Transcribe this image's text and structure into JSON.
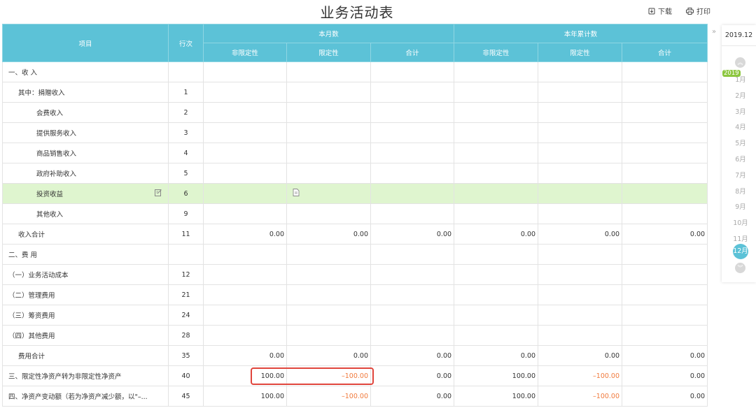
{
  "title": "业务活动表",
  "toolbar": {
    "download": "下载",
    "print": "打印"
  },
  "header": {
    "item": "项目",
    "line": "行次",
    "month_group": "本月数",
    "year_group": "本年累计数",
    "sub": [
      "非限定性",
      "限定性",
      "合计",
      "非限定性",
      "限定性",
      "合计"
    ]
  },
  "rows": [
    {
      "label": "一、收 入",
      "indent": 0,
      "line": "",
      "values": [
        "",
        "",
        "",
        "",
        "",
        ""
      ]
    },
    {
      "label": "其中：捐赠收入",
      "indent": 1,
      "line": "1",
      "values": [
        "",
        "",
        "",
        "",
        "",
        ""
      ]
    },
    {
      "label": "会费收入",
      "indent": 2,
      "line": "2",
      "values": [
        "",
        "",
        "",
        "",
        "",
        ""
      ]
    },
    {
      "label": "提供服务收入",
      "indent": 2,
      "line": "3",
      "values": [
        "",
        "",
        "",
        "",
        "",
        ""
      ]
    },
    {
      "label": "商品销售收入",
      "indent": 2,
      "line": "4",
      "values": [
        "",
        "",
        "",
        "",
        "",
        ""
      ]
    },
    {
      "label": "政府补助收入",
      "indent": 2,
      "line": "5",
      "values": [
        "",
        "",
        "",
        "",
        "",
        ""
      ]
    },
    {
      "label": "投资收益",
      "indent": 2,
      "line": "6",
      "values": [
        "",
        "",
        "",
        "",
        "",
        ""
      ],
      "highlight": true,
      "edit_icon": "edit-icon",
      "cell_icon": "document-icon"
    },
    {
      "label": "其他收入",
      "indent": 2,
      "line": "9",
      "values": [
        "",
        "",
        "",
        "",
        "",
        ""
      ]
    },
    {
      "label": "收入合计",
      "indent": 1,
      "line": "11",
      "values": [
        "0.00",
        "0.00",
        "0.00",
        "0.00",
        "0.00",
        "0.00"
      ]
    },
    {
      "label": "二、费 用",
      "indent": 0,
      "line": "",
      "values": [
        "",
        "",
        "",
        "",
        "",
        ""
      ]
    },
    {
      "label": "（一）业务活动成本",
      "indent": 0,
      "line": "12",
      "values": [
        "",
        "",
        "",
        "",
        "",
        ""
      ]
    },
    {
      "label": "（二）管理费用",
      "indent": 0,
      "line": "21",
      "values": [
        "",
        "",
        "",
        "",
        "",
        ""
      ]
    },
    {
      "label": "（三）筹资费用",
      "indent": 0,
      "line": "24",
      "values": [
        "",
        "",
        "",
        "",
        "",
        ""
      ]
    },
    {
      "label": "（四）其他费用",
      "indent": 0,
      "line": "28",
      "values": [
        "",
        "",
        "",
        "",
        "",
        ""
      ]
    },
    {
      "label": "费用合计",
      "indent": 1,
      "line": "35",
      "values": [
        "0.00",
        "0.00",
        "0.00",
        "0.00",
        "0.00",
        "0.00"
      ]
    },
    {
      "label": "三、限定性净资产转为非限定性净资产",
      "indent": 0,
      "line": "40",
      "values": [
        "100.00",
        "–100.00",
        "0.00",
        "100.00",
        "–100.00",
        "0.00"
      ]
    },
    {
      "label": "四、净资产变动额（若为净资产减少额，以\"–...",
      "indent": 0,
      "line": "45",
      "values": [
        "100.00",
        "–100.00",
        "0.00",
        "100.00",
        "–100.00",
        "0.00"
      ]
    }
  ],
  "colors": {
    "header": "#5cc2d7",
    "highlight_row": "#dff5cf",
    "negative": "#f07a3c",
    "callout": "#e0453c",
    "year_badge": "#8cc63f"
  },
  "period_panel": {
    "selected": "2019.12",
    "year_badge": "2019",
    "months": [
      "1月",
      "2月",
      "3月",
      "4月",
      "5月",
      "6月",
      "7月",
      "8月",
      "9月",
      "10月",
      "11月",
      "12月"
    ],
    "active_month": "12月",
    "up_icon": "chevron-up-icon",
    "down_icon": "chevron-down-icon",
    "collapse_icon": "double-chevron-right-icon"
  }
}
